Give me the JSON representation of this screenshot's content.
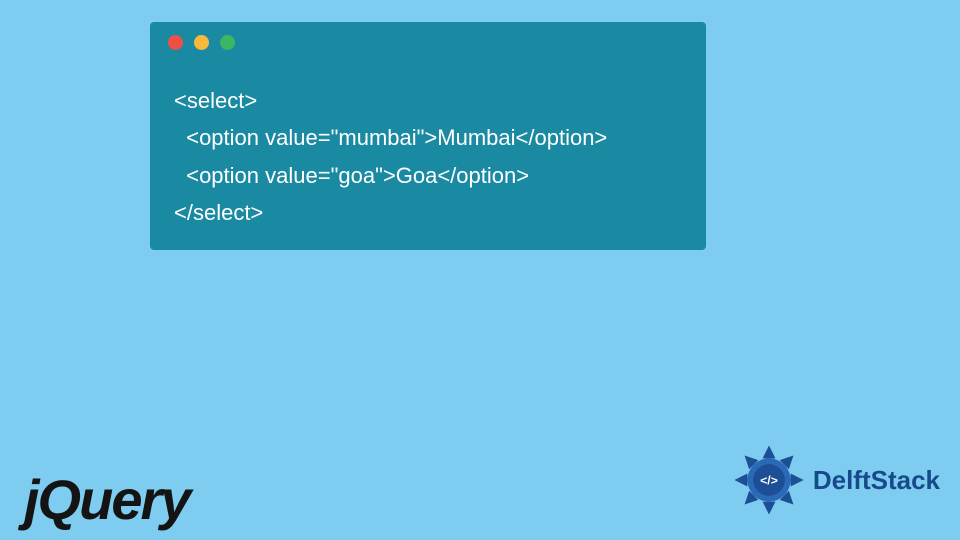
{
  "window": {
    "traffic_lights": [
      "red",
      "yellow",
      "green"
    ],
    "code_lines": [
      "<select>",
      "  <option value=\"mumbai\">Mumbai</option>",
      "  <option value=\"goa\">Goa</option>",
      "</select>"
    ]
  },
  "logos": {
    "jquery": "jQuery",
    "delftstack": "DelftStack"
  },
  "colors": {
    "page_bg": "#7ecdf0",
    "window_bg": "#1a8aa3",
    "code_text": "#ffffff",
    "jquery_text": "#141414",
    "delft_text": "#164a8a",
    "delft_badge_outer": "#1c4f95",
    "delft_badge_inner": "#2a69b5"
  }
}
